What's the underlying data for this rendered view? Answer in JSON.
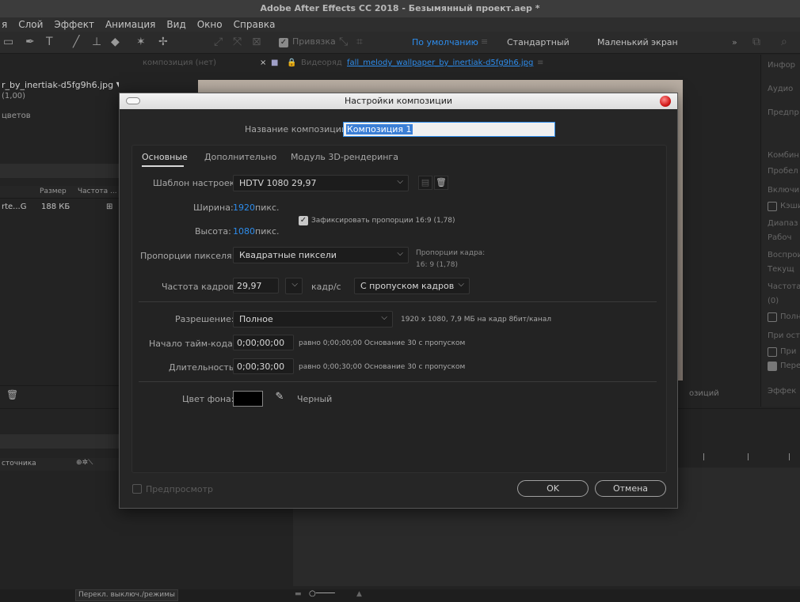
{
  "app": {
    "title": "Adobe After Effects CC 2018 - Безымянный проект.aep *"
  },
  "menu": [
    "я",
    "Слой",
    "Эффект",
    "Анимация",
    "Вид",
    "Окно",
    "Справка"
  ],
  "toolbar": {
    "snap_label": "Привязка",
    "workspaces": [
      "По умолчанию",
      "Стандартный",
      "Маленький экран"
    ],
    "more": "»"
  },
  "project_panel": {
    "file_name": "r_by_inertiak-d5fg9h6.jpg ▼",
    "file_sub": "(1,00)",
    "colors_label": "цветов",
    "col_size": "Размер",
    "col_rate": "Частота ...",
    "row_name": "rte...G",
    "row_size": "188 КБ"
  },
  "comp_panel": {
    "tab_comp": "композиция (нет)",
    "tab_footage_label": "Видеоряд",
    "tab_footage_file": "fall_melody_wallpaper_by_inertiak-d5fg9h6.jpg",
    "tab_menu": "≡",
    "bottom_label": "озиций"
  },
  "right_panel": {
    "items": [
      "Инфор",
      "Аудио",
      "Предпр",
      "Комбин",
      "Пробел",
      "Включи",
      "Кэши",
      "Диапаз",
      "Рабоч",
      "Воспрои",
      "Текущ",
      "Частота",
      "(0)",
      "Полн",
      "При оста",
      "При",
      "Пере",
      "Эффек"
    ]
  },
  "timeline": {
    "col_source": "сточника",
    "toggle_label": "Перекл. выключ./режимы"
  },
  "dialog": {
    "title": "Настройки композиции",
    "name_label": "Название композиции:",
    "name_value": "Композиция 1",
    "tabs": [
      "Основные",
      "Дополнительно",
      "Модуль 3D-рендеринга"
    ],
    "preset_label": "Шаблон настроек:",
    "preset_value": "HDTV 1080 29,97",
    "width_label": "Ширина:",
    "width_value": "1920",
    "height_label": "Высота:",
    "height_value": "1080",
    "unit_px": "пикс.",
    "lock_label": "Зафиксировать пропорции 16:9 (1,78)",
    "par_label": "Пропорции пикселя:",
    "par_value": "Квадратные пиксели",
    "frame_aspect_label": "Пропорции кадра:",
    "frame_aspect_value": "16: 9 (1,78)",
    "fps_label": "Частота кадров:",
    "fps_value": "29,97",
    "fps_unit": "кадр/с",
    "drop_value": "С пропуском кадров",
    "res_label": "Разрешение:",
    "res_value": "Полное",
    "res_info": "1920 x 1080, 7,9 МБ на кадр 8бит/канал",
    "start_label": "Начало тайм-кода:",
    "start_value": "0;00;00;00",
    "start_info": "равно 0;00;00;00  Основание 30  с пропуском",
    "dur_label": "Длительность:",
    "dur_value": "0;00;30;00",
    "dur_info": "равно 0;00;30;00  Основание 30  с пропуском",
    "bg_label": "Цвет фона:",
    "bg_name": "Черный",
    "bg_color": "#000000",
    "preview_label": "Предпросмотр",
    "ok": "OK",
    "cancel": "Отмена"
  },
  "colors": {
    "accent": "#2d8ceb"
  }
}
